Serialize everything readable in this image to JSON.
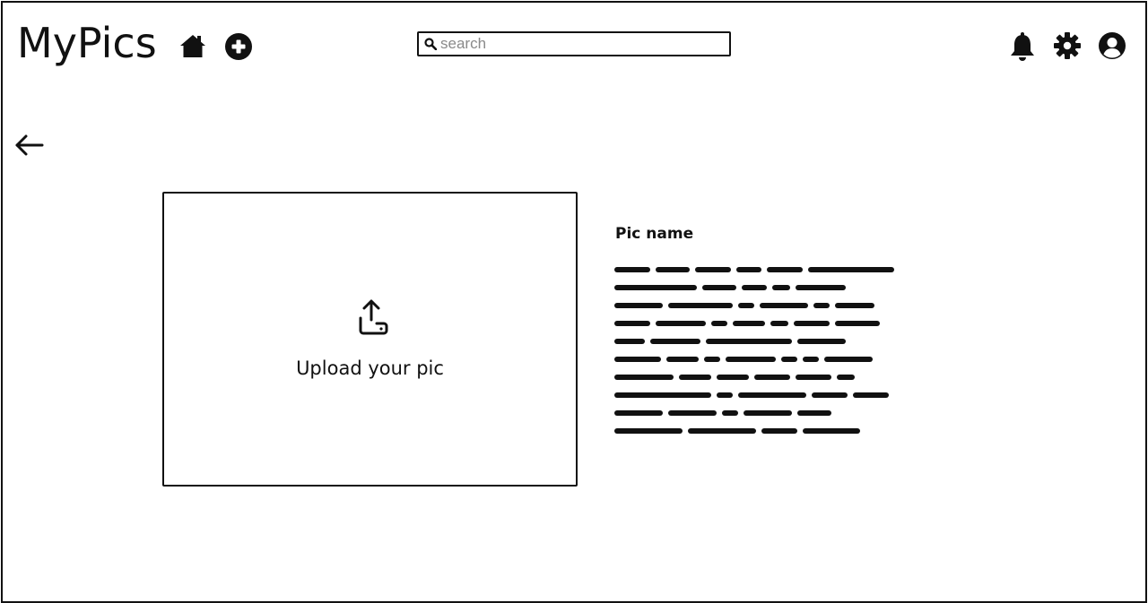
{
  "app": {
    "title": "MyPics"
  },
  "header": {
    "nav_icons": [
      "home-icon",
      "add-circle-icon"
    ],
    "search": {
      "placeholder": "search",
      "value": ""
    },
    "right_icons": [
      "bell-icon",
      "gear-icon",
      "user-circle-icon"
    ]
  },
  "page": {
    "back_icon": "arrow-left-icon",
    "upload": {
      "icon": "upload-icon",
      "label": "Upload your pic"
    },
    "details": {
      "pic_name_label": "Pic name",
      "description_lines": 10
    }
  },
  "colors": {
    "ink": "#111111",
    "placeholder": "#8a8a8a",
    "background": "#ffffff"
  }
}
